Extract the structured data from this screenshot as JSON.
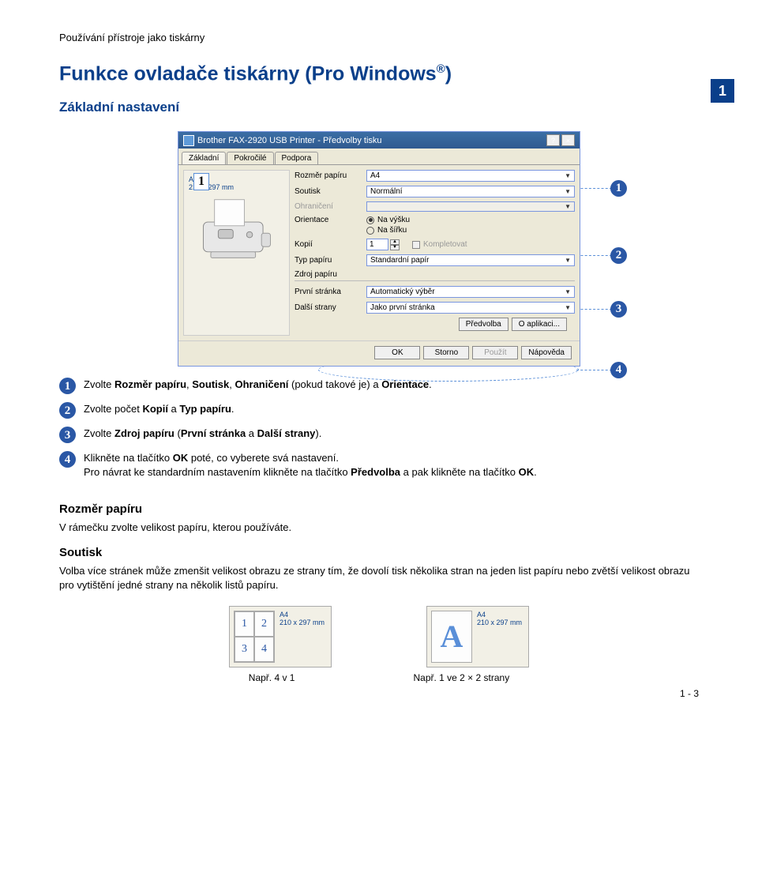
{
  "header_path": "Používání přístroje jako tiskárny",
  "main_title_prefix": "Funkce ovladače tiskárny (Pro Windows",
  "main_title_suffix": ")",
  "main_title_reg": "®",
  "sub_title": "Základní nastavení",
  "side_chapter": "1",
  "dialog": {
    "title": "Brother FAX-2920 USB Printer - Předvolby tisku",
    "help_btn": "?",
    "close_btn": "×",
    "tabs": {
      "basic": "Základní",
      "advanced": "Pokročilé",
      "support": "Podpora"
    },
    "preview": {
      "size_line1": "A4",
      "size_line2": "210 x 297 mm"
    },
    "labels": {
      "paper_size": "Rozměr papíru",
      "multipage": "Soutisk",
      "border": "Ohraničení",
      "orientation": "Orientace",
      "portrait": "Na výšku",
      "landscape": "Na šířku",
      "copies": "Kopií",
      "collate": "Kompletovat",
      "paper_type": "Typ papíru",
      "paper_source": "Zdroj papíru",
      "first_page": "První stránka",
      "other_pages": "Další strany"
    },
    "values": {
      "paper_size": "A4",
      "multipage": "Normální",
      "border": "",
      "copies": "1",
      "paper_type": "Standardní papír",
      "first_page": "Automatický výběr",
      "other_pages": "Jako první stránka"
    },
    "buttons_top": {
      "default": "Předvolba",
      "about": "O aplikaci..."
    },
    "buttons_bot": {
      "ok": "OK",
      "cancel": "Storno",
      "apply": "Použít",
      "help": "Nápověda"
    }
  },
  "left_box_num": "1",
  "callouts": {
    "c1": "1",
    "c2": "2",
    "c3": "3",
    "c4": "4"
  },
  "instructions": {
    "i1_a": "Zvolte ",
    "i1_b1": "Rozměr papíru",
    "i1_comma1": ", ",
    "i1_b2": "Soutisk",
    "i1_comma2": ", ",
    "i1_b3": "Ohraničení",
    "i1_mid": " (pokud takové je) a ",
    "i1_b4": "Orientace",
    "i1_end": ".",
    "i2_a": "Zvolte počet ",
    "i2_b1": "Kopií",
    "i2_mid": " a ",
    "i2_b2": "Typ papíru",
    "i2_end": ".",
    "i3_a": "Zvolte ",
    "i3_b1": "Zdroj papíru",
    "i3_mid": " (",
    "i3_b2": "První stránka",
    "i3_mid2": " a ",
    "i3_b3": "Další strany",
    "i3_end": ").",
    "i4_a": "Klikněte na tlačítko ",
    "i4_b1": "OK",
    "i4_mid": " poté, co vyberete svá nastavení.",
    "i4_2a": "Pro návrat ke standardním nastavením klikněte na tlačítko ",
    "i4_2b1": "Předvolba",
    "i4_2mid": " a pak klikněte na tlačítko ",
    "i4_2b2": "OK",
    "i4_2end": "."
  },
  "section2": {
    "h1": "Rozměr papíru",
    "p1": "V rámečku zvolte velikost papíru, kterou používáte.",
    "h2": "Soutisk",
    "p2": "Volba více stránek může zmenšit velikost obrazu ze strany tím, že dovolí tisk několika stran na jeden list papíru nebo zvětší velikost obrazu pro vytištění jedné strany na několik listů papíru."
  },
  "examples": {
    "grid": {
      "a": "1",
      "b": "2",
      "c": "3",
      "d": "4"
    },
    "spec_line1": "A4",
    "spec_line2": "210 x 297 mm",
    "cap1": "Např. 4 v 1",
    "cap2": "Např. 1 ve 2 × 2 strany"
  },
  "page_num": "1 - 3"
}
